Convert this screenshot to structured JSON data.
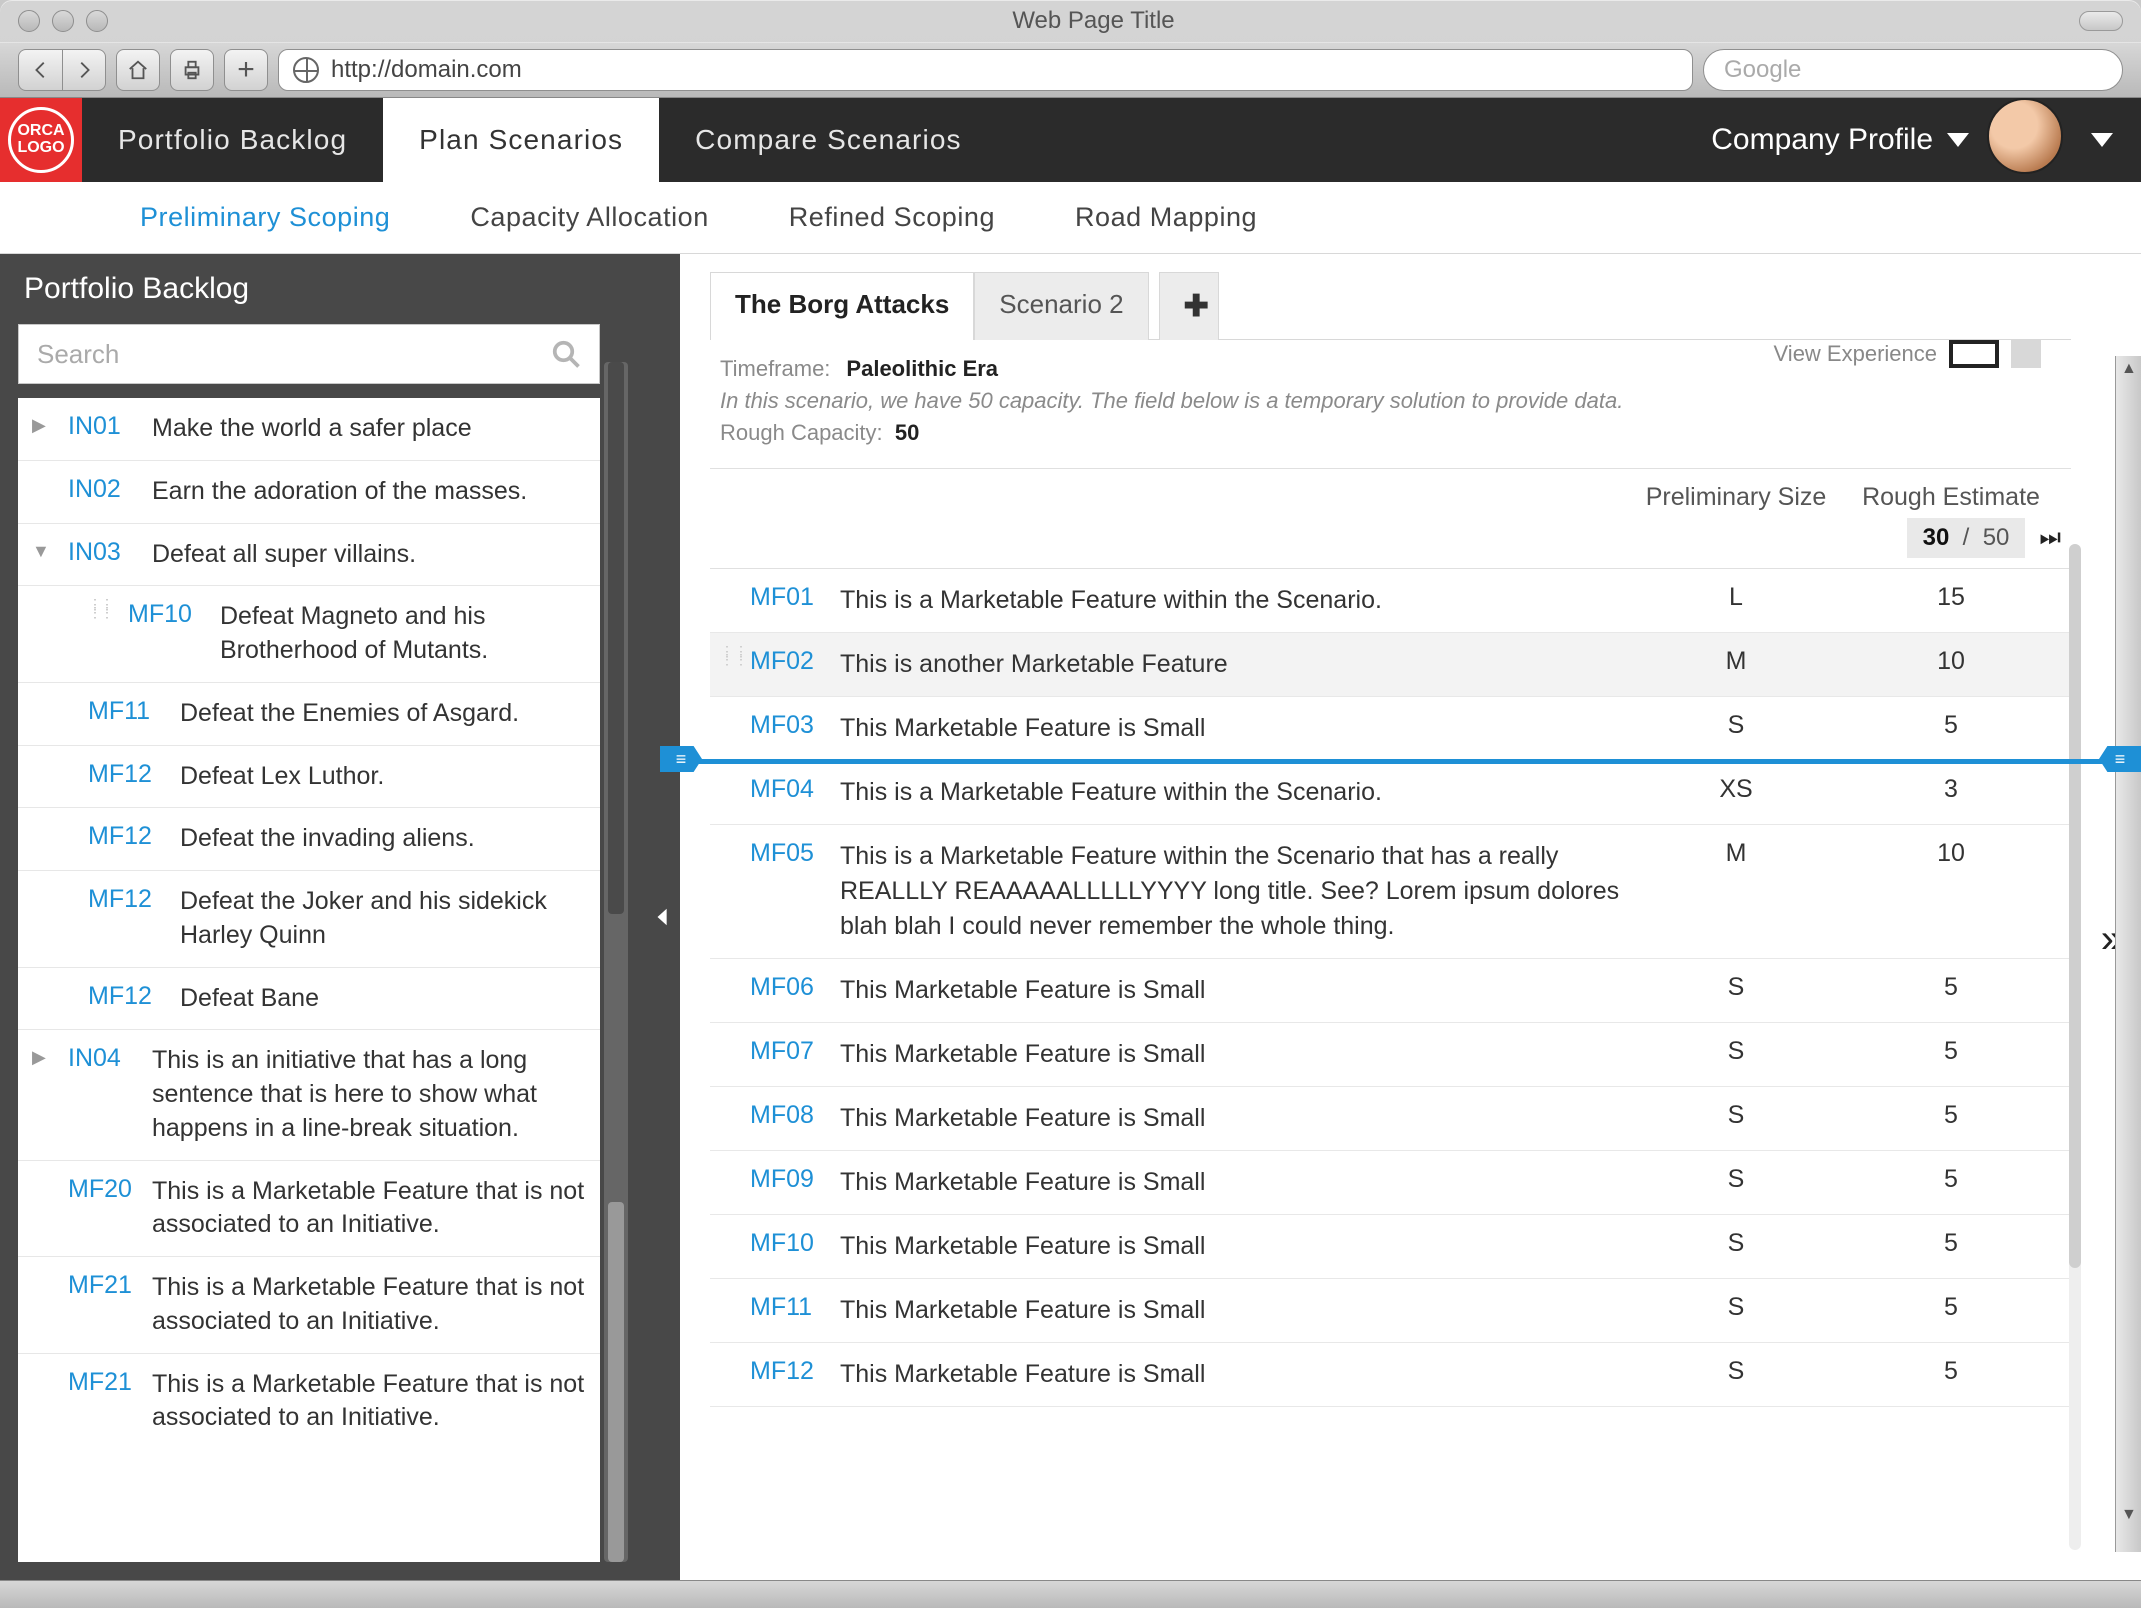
{
  "window": {
    "title": "Web Page Title",
    "url": "http://domain.com",
    "search_placeholder": "Google"
  },
  "logo_text": "ORCA LOGO",
  "top_nav": {
    "items": [
      {
        "label": "Portfolio Backlog",
        "active": false
      },
      {
        "label": "Plan Scenarios",
        "active": true
      },
      {
        "label": "Compare Scenarios",
        "active": false
      }
    ],
    "company_profile_label": "Company Profile"
  },
  "sub_nav": {
    "items": [
      {
        "label": "Preliminary Scoping",
        "active": true
      },
      {
        "label": "Capacity Allocation",
        "active": false
      },
      {
        "label": "Refined Scoping",
        "active": false
      },
      {
        "label": "Road Mapping",
        "active": false
      }
    ]
  },
  "sidebar": {
    "title": "Portfolio Backlog",
    "search_placeholder": "Search",
    "items": [
      {
        "type": "initiative",
        "expander": "▶",
        "code": "IN01",
        "text": "Make the world a safer place"
      },
      {
        "type": "initiative",
        "expander": "",
        "code": "IN02",
        "text": "Earn the adoration of the masses."
      },
      {
        "type": "initiative",
        "expander": "▼",
        "code": "IN03",
        "text": "Defeat all super villains."
      },
      {
        "type": "feature",
        "code": "MF10",
        "text": "Defeat Magneto and his Brotherhood of Mutants.",
        "drag": true
      },
      {
        "type": "feature",
        "code": "MF11",
        "text": "Defeat the Enemies of Asgard."
      },
      {
        "type": "feature",
        "code": "MF12",
        "text": "Defeat Lex Luthor."
      },
      {
        "type": "feature",
        "code": "MF12",
        "text": "Defeat the invading aliens."
      },
      {
        "type": "feature",
        "code": "MF12",
        "text": "Defeat the Joker and his sidekick Harley Quinn"
      },
      {
        "type": "feature",
        "code": "MF12",
        "text": "Defeat Bane"
      },
      {
        "type": "initiative",
        "expander": "▶",
        "code": "IN04",
        "text": "This is an initiative that has a long sentence that is here to show what happens in a line-break situation."
      },
      {
        "type": "feature-noindent",
        "code": "MF20",
        "text": "This is a Marketable Feature that is not associated to an Initiative."
      },
      {
        "type": "feature-noindent",
        "code": "MF21",
        "text": "This is a Marketable Feature that is not associated to an Initiative."
      },
      {
        "type": "feature-noindent",
        "code": "MF21",
        "text": "This is a Marketable Feature that is not associated to an Initiative."
      }
    ]
  },
  "main": {
    "scenario_tabs": [
      {
        "label": "The Borg Attacks",
        "active": true
      },
      {
        "label": "Scenario 2",
        "active": false
      }
    ],
    "timeframe_label": "Timeframe:",
    "timeframe_value": "Paleolithic Era",
    "scenario_desc": "In this scenario, we have 50 capacity. The field below is a temporary solution to provide data.",
    "rough_capacity_label": "Rough Capacity:",
    "rough_capacity_value": "50",
    "view_experience_label": "View Experience",
    "columns": {
      "c4": "Preliminary Size",
      "c5": "Rough Estimate"
    },
    "capacity_readout": {
      "used": "30",
      "sep": "/",
      "total": "50"
    },
    "features": [
      {
        "code": "MF01",
        "title": "This is a Marketable Feature within the Scenario.",
        "size": "L",
        "est": "15",
        "highlight": false
      },
      {
        "code": "MF02",
        "title": "This is another Marketable Feature",
        "size": "M",
        "est": "10",
        "highlight": true,
        "drag": true
      },
      {
        "code": "MF03",
        "title": "This Marketable Feature is Small",
        "size": "S",
        "est": "5",
        "highlight": false
      },
      {
        "_cutline": true
      },
      {
        "code": "MF04",
        "title": "This is a Marketable Feature within the Scenario.",
        "size": "XS",
        "est": "3",
        "highlight": false
      },
      {
        "code": "MF05",
        "title": "This is a Marketable Feature within the Scenario that has a really REALLLY REAAAAALLLLLYYYY long title. See? Lorem ipsum dolores blah blah I could never remember the whole thing.",
        "size": "M",
        "est": "10",
        "highlight": false
      },
      {
        "code": "MF06",
        "title": "This Marketable Feature is Small",
        "size": "S",
        "est": "5",
        "highlight": false
      },
      {
        "code": "MF07",
        "title": "This Marketable Feature is Small",
        "size": "S",
        "est": "5",
        "highlight": false
      },
      {
        "code": "MF08",
        "title": "This Marketable Feature is Small",
        "size": "S",
        "est": "5",
        "highlight": false
      },
      {
        "code": "MF09",
        "title": "This Marketable Feature is Small",
        "size": "S",
        "est": "5",
        "highlight": false
      },
      {
        "code": "MF10",
        "title": "This Marketable Feature is Small",
        "size": "S",
        "est": "5",
        "highlight": false
      },
      {
        "code": "MF11",
        "title": "This Marketable Feature is Small",
        "size": "S",
        "est": "5",
        "highlight": false
      },
      {
        "code": "MF12",
        "title": "This Marketable Feature is Small",
        "size": "S",
        "est": "5",
        "highlight": false
      }
    ]
  }
}
